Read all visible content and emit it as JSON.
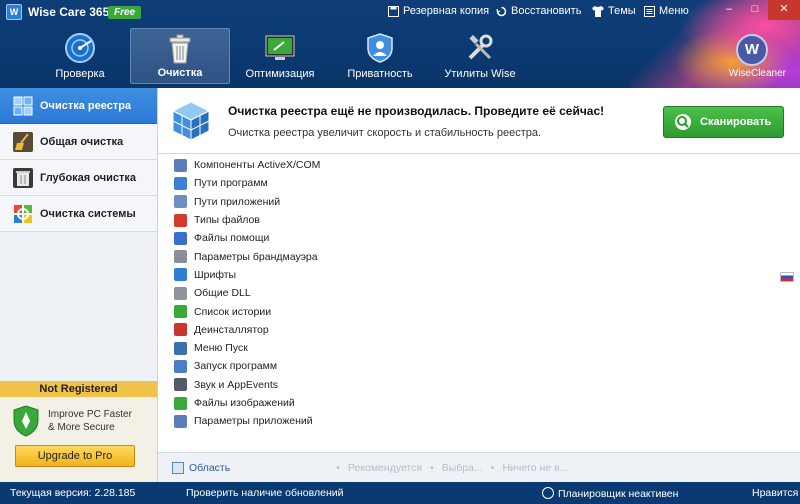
{
  "app": {
    "title": "Wise Care 365",
    "badge": "Free"
  },
  "topmenu": {
    "backup": "Резервная копия",
    "restore": "Восстановить",
    "themes": "Темы",
    "menu": "Меню"
  },
  "nav": [
    {
      "label": "Проверка",
      "icon": "radar-icon"
    },
    {
      "label": "Очистка",
      "icon": "trash-icon"
    },
    {
      "label": "Оптимизация",
      "icon": "monitor-broom-icon"
    },
    {
      "label": "Приватность",
      "icon": "shield-user-icon"
    },
    {
      "label": "Утилиты Wise",
      "icon": "tools-icon"
    }
  ],
  "brand": {
    "logo_letter": "W",
    "label": "WiseCleaner"
  },
  "sidebar": {
    "items": [
      {
        "label": "Очистка реестра",
        "active": true
      },
      {
        "label": "Общая очистка",
        "active": false
      },
      {
        "label": "Глубокая очистка",
        "active": false
      },
      {
        "label": "Очистка системы",
        "active": false
      }
    ]
  },
  "registration": {
    "title": "Not Registered",
    "text_line1": "Improve PC Faster",
    "text_line2": "& More Secure",
    "upgrade_label": "Upgrade to Pro"
  },
  "banner": {
    "title": "Очистка реестра ещё не производилась. Проведите её сейчас!",
    "subtitle": "Очистка реестра увеличит скорость и стабильность реестра.",
    "scan_label": "Сканировать"
  },
  "registry_items": [
    {
      "label": "Компоненты ActiveX/COM",
      "color": "#5a7fb8"
    },
    {
      "label": "Пути программ",
      "color": "#3f7fd0"
    },
    {
      "label": "Пути приложений",
      "color": "#6a8fc0"
    },
    {
      "label": "Типы файлов",
      "color": "#d33a2c"
    },
    {
      "label": "Файлы помощи",
      "color": "#3a6fd0"
    },
    {
      "label": "Параметры брандмауэра",
      "color": "#8a8f98"
    },
    {
      "label": "Шрифты",
      "color": "#2d7fd6"
    },
    {
      "label": "Общие DLL",
      "color": "#8e949c"
    },
    {
      "label": "Список истории",
      "color": "#3aa83a"
    },
    {
      "label": "Деинсталлятор",
      "color": "#c8372d"
    },
    {
      "label": "Меню Пуск",
      "color": "#3a6fb0"
    },
    {
      "label": "Запуск программ",
      "color": "#4a7ec8"
    },
    {
      "label": "Звук и AppEvents",
      "color": "#555b66"
    },
    {
      "label": "Файлы изображений",
      "color": "#3aa83a"
    },
    {
      "label": "Параметры приложений",
      "color": "#5a7fb8"
    }
  ],
  "bottom": {
    "area": "Область",
    "recommended": "Рекомендуется",
    "selected": "Выбра...",
    "nothing": "Ничего не в..."
  },
  "status": {
    "version": "Текущая версия: 2.28.185",
    "check_updates": "Проверить наличие обновлений",
    "scheduler": "Планировщик неактивен",
    "like": "Нравится"
  }
}
